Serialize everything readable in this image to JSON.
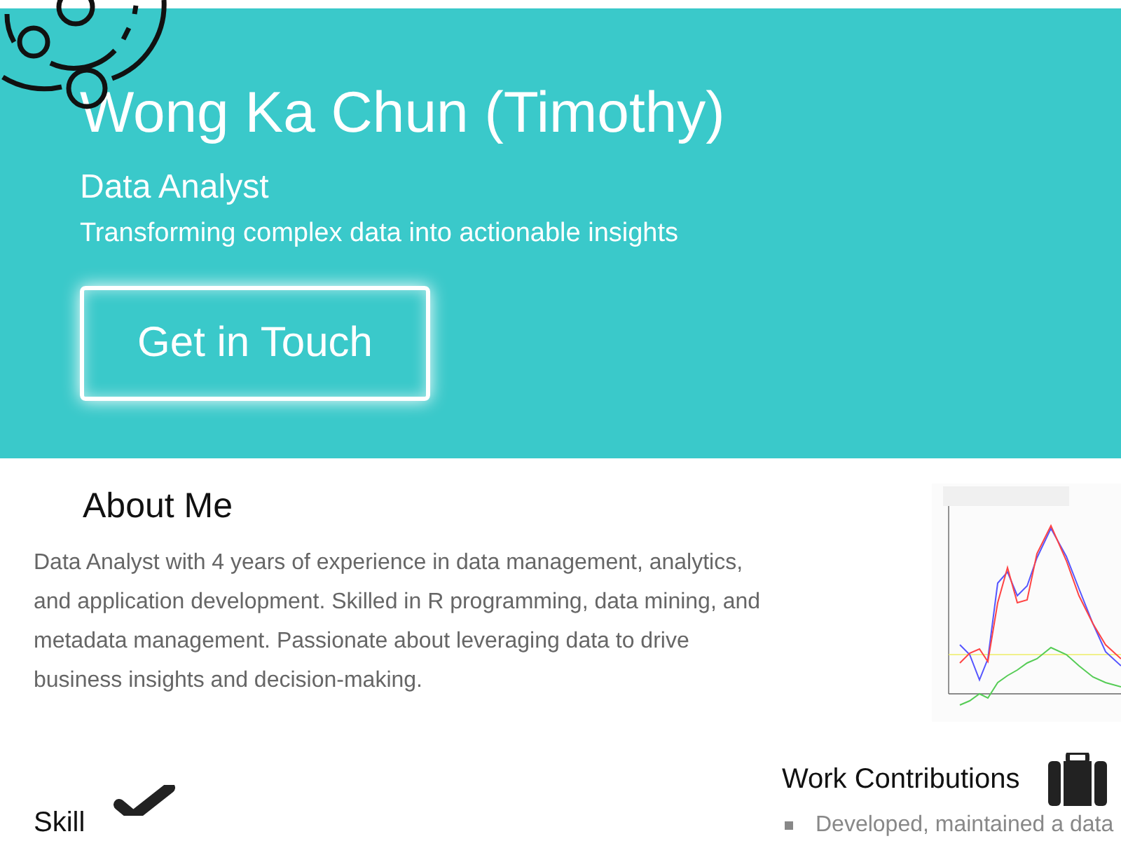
{
  "hero": {
    "name": "Wong Ka Chun (Timothy)",
    "role": "Data Analyst",
    "tagline": "Transforming complex data into actionable insights",
    "button": "Get in Touch"
  },
  "about": {
    "heading": "About Me",
    "text": "Data Analyst with 4 years of experience in data management, analytics, and application development. Skilled in R programming, data mining, and metadata management. Passionate about leveraging data to drive business insights and decision-making."
  },
  "work": {
    "heading": "Work Contributions",
    "items": [
      "Developed, maintained a data"
    ]
  },
  "skills": {
    "heading": "Skill"
  }
}
